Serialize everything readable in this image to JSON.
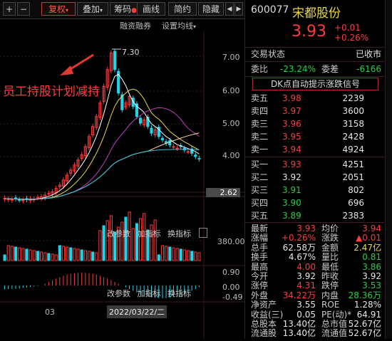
{
  "toolbar": {
    "plus": "+",
    "minus": "−",
    "fuquan": "复权",
    "diejia": "叠加",
    "chouma": "筹码",
    "huaxian": "画线",
    "jianyue": "简约",
    "yincang": "隐藏",
    "left_arrow": "◀",
    "right_arrow": "▶"
  },
  "subbar": {
    "rongzi": "融资融券",
    "junxian": "设置均线"
  },
  "chart": {
    "peak_label": "7.30",
    "current_price_label": "2.62",
    "annotation": "员工持股计划减持",
    "price_ticks": [
      "7.00",
      "6.00",
      "5.00",
      "4.00"
    ],
    "volume_tick": "380.00",
    "macd_ticks": [
      "0.90",
      "0.00",
      "-0.49"
    ],
    "vol_toolbar": [
      "改参数",
      "加指标",
      "换指标"
    ],
    "macd_toolbar": [
      "改参数",
      "加指标",
      "换指标"
    ],
    "date_month": "03",
    "date_label": "2022/03/22/二"
  },
  "chart_data": {
    "type": "candlestick",
    "ylim": [
      2.5,
      7.5
    ],
    "peak": 7.3,
    "last": 3.93
  },
  "stock": {
    "code": "600077",
    "name": "宋都股份",
    "price": "3.93",
    "change": "+0.01",
    "change_pct": "+0.26%"
  },
  "status": {
    "label": "交易状态",
    "value": "已收市"
  },
  "ratio": {
    "weibi_label": "委比",
    "weibi": "-23.24%",
    "weicha_label": "委差",
    "weicha": "-6166"
  },
  "dk_signal": "DK点自动提示涨跌信号",
  "sell": [
    {
      "label": "卖五",
      "price": "3.98",
      "vol": "2239"
    },
    {
      "label": "卖四",
      "price": "3.97",
      "vol": "3600"
    },
    {
      "label": "卖三",
      "price": "3.96",
      "vol": "3158"
    },
    {
      "label": "卖二",
      "price": "3.95",
      "vol": "2428"
    },
    {
      "label": "卖一",
      "price": "3.94",
      "vol": "4924"
    }
  ],
  "buy": [
    {
      "label": "买一",
      "price": "3.93",
      "vol": "4251"
    },
    {
      "label": "买二",
      "price": "3.92",
      "vol": "2051"
    },
    {
      "label": "买三",
      "price": "3.91",
      "vol": "802"
    },
    {
      "label": "买四",
      "price": "3.90",
      "vol": "696"
    },
    {
      "label": "买五",
      "price": "3.89",
      "vol": "2383"
    }
  ],
  "stats": [
    {
      "l1": "最新",
      "v1": "3.93",
      "c1": "red",
      "l2": "均价",
      "v2": "3.94",
      "c2": "red"
    },
    {
      "l1": "涨幅",
      "v1": "+0.26%",
      "c1": "red",
      "l2": "涨跌",
      "v2": "▲0.01",
      "c2": "red"
    },
    {
      "l1": "总手",
      "v1": "62.58万",
      "c1": "white",
      "l2": "金额",
      "v2": "2.47亿",
      "c2": "yellow"
    },
    {
      "l1": "换手",
      "v1": "4.67%",
      "c1": "white",
      "l2": "量比",
      "v2": "0.81",
      "c2": "green"
    },
    {
      "l1": "最高",
      "v1": "4.00",
      "c1": "red",
      "l2": "最低",
      "v2": "3.86",
      "c2": "green"
    },
    {
      "l1": "今开",
      "v1": "3.92",
      "c1": "white",
      "l2": "昨收",
      "v2": "3.92",
      "c2": "white"
    },
    {
      "l1": "涨停",
      "v1": "4.31",
      "c1": "red",
      "l2": "跌停",
      "v2": "3.53",
      "c2": "green"
    },
    {
      "l1": "外盘",
      "v1": "34.22万",
      "c1": "red",
      "l2": "内盘",
      "v2": "28.36万",
      "c2": "green"
    },
    {
      "l1": "净资产",
      "v1": "3.55",
      "c1": "white",
      "l2": "ROE",
      "v2": "1.28%",
      "c2": "white"
    },
    {
      "l1": "收益(三)",
      "v1": "0.05",
      "c1": "white",
      "l2": "PE(动)*",
      "v2": "64.91",
      "c2": "white"
    },
    {
      "l1": "总股本",
      "v1": "13.40亿",
      "c1": "white",
      "l2": "总市值",
      "v2": "52.67亿",
      "c2": "white"
    },
    {
      "l1": "流通股",
      "v1": "13.40亿",
      "c1": "white",
      "l2": "流通值",
      "v2": "52.67亿",
      "c2": "white"
    }
  ],
  "colors": {
    "up": "#ff3b3b",
    "down": "#22d3e8",
    "green": "#22d33a",
    "accent": "#e8d84a"
  }
}
